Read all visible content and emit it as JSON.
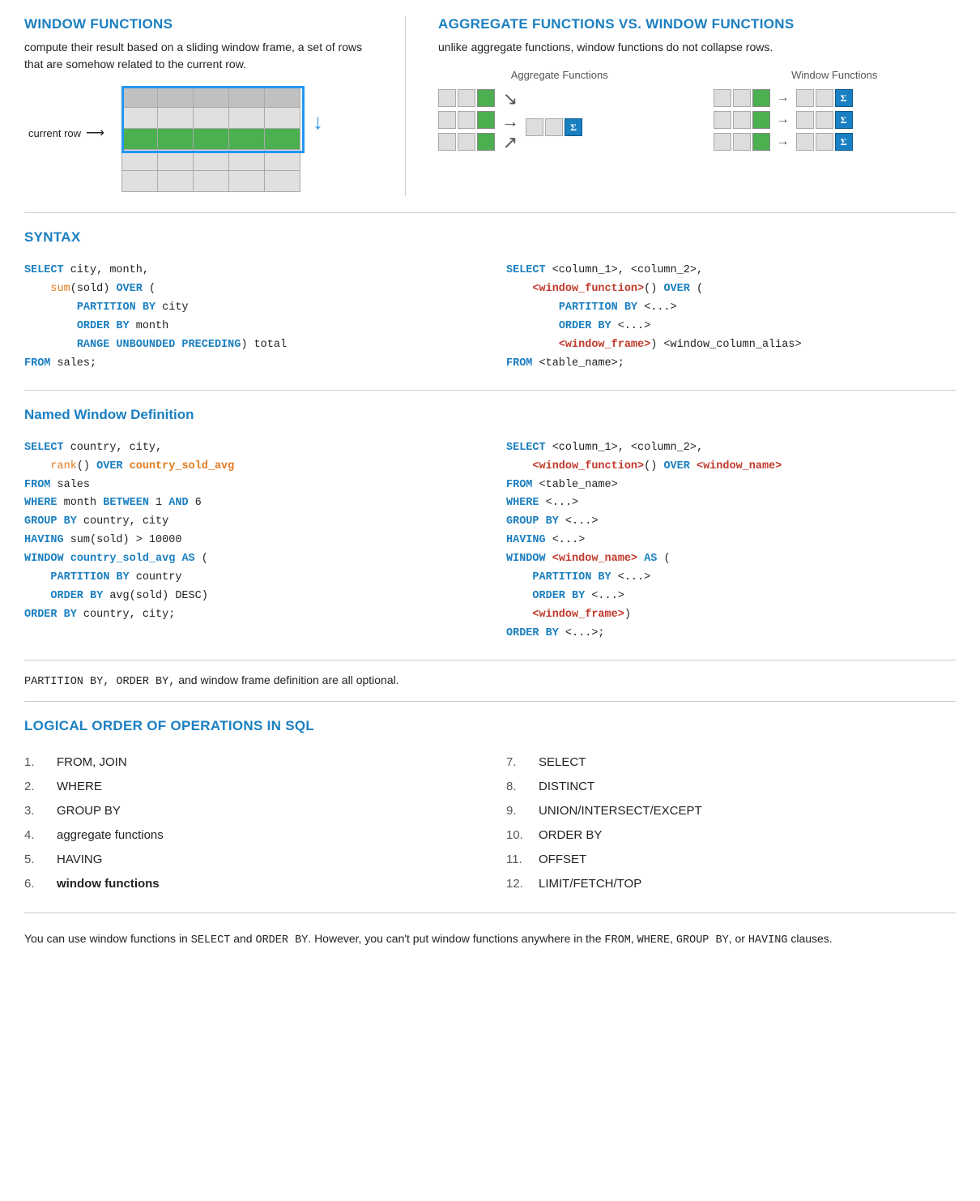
{
  "windowFunctions": {
    "title": "WINDOW FUNCTIONS",
    "description": "compute their result based on a sliding window frame, a set of rows that are somehow related to the current row.",
    "currentRowLabel": "current row"
  },
  "aggregateVsWindow": {
    "title": "AGGREGATE FUNCTIONS VS. WINDOW FUNCTIONS",
    "description": "unlike aggregate functions, window functions do not collapse rows.",
    "aggregateLabel": "Aggregate Functions",
    "windowLabel": "Window Functions"
  },
  "syntax": {
    "title": "SYNTAX",
    "example1": {
      "lines": [
        {
          "parts": [
            {
              "text": "SELECT",
              "cls": "kw-blue"
            },
            {
              "text": " city, month,",
              "cls": "normal"
            }
          ]
        },
        {
          "parts": [
            {
              "text": "    ",
              "cls": "normal"
            },
            {
              "text": "sum",
              "cls": "fn-orange"
            },
            {
              "text": "(sold) ",
              "cls": "normal"
            },
            {
              "text": "OVER",
              "cls": "kw-blue"
            },
            {
              "text": " (",
              "cls": "normal"
            }
          ]
        },
        {
          "parts": [
            {
              "text": "        ",
              "cls": "normal"
            },
            {
              "text": "PARTITION BY",
              "cls": "kw-blue"
            },
            {
              "text": " city",
              "cls": "normal"
            }
          ]
        },
        {
          "parts": [
            {
              "text": "        ",
              "cls": "normal"
            },
            {
              "text": "ORDER BY",
              "cls": "kw-blue"
            },
            {
              "text": " month",
              "cls": "normal"
            }
          ]
        },
        {
          "parts": [
            {
              "text": "        ",
              "cls": "normal"
            },
            {
              "text": "RANGE UNBOUNDED PRECEDING",
              "cls": "kw-blue"
            },
            {
              "text": ") total",
              "cls": "normal"
            }
          ]
        },
        {
          "parts": [
            {
              "text": "FROM",
              "cls": "kw-blue"
            },
            {
              "text": " sales;",
              "cls": "normal"
            }
          ]
        }
      ]
    },
    "example2": {
      "lines": [
        {
          "parts": [
            {
              "text": "SELECT",
              "cls": "kw-blue"
            },
            {
              "text": " <column_1>, <column_2>,",
              "cls": "normal"
            }
          ]
        },
        {
          "parts": [
            {
              "text": "    ",
              "cls": "normal"
            },
            {
              "text": "<window_function>",
              "cls": "angle"
            },
            {
              "text": "() ",
              "cls": "normal"
            },
            {
              "text": "OVER",
              "cls": "kw-blue"
            },
            {
              "text": " (",
              "cls": "normal"
            }
          ]
        },
        {
          "parts": [
            {
              "text": "        ",
              "cls": "normal"
            },
            {
              "text": "PARTITION BY",
              "cls": "kw-blue"
            },
            {
              "text": " <...>",
              "cls": "normal"
            }
          ]
        },
        {
          "parts": [
            {
              "text": "        ",
              "cls": "normal"
            },
            {
              "text": "ORDER BY",
              "cls": "kw-blue"
            },
            {
              "text": " <...>",
              "cls": "normal"
            }
          ]
        },
        {
          "parts": [
            {
              "text": "        ",
              "cls": "normal"
            },
            {
              "text": "<window_frame>",
              "cls": "angle"
            },
            {
              "text": ") <window_column_alias>",
              "cls": "normal"
            }
          ]
        },
        {
          "parts": [
            {
              "text": "FROM",
              "cls": "kw-blue"
            },
            {
              "text": " <table_name>;",
              "cls": "normal"
            }
          ]
        }
      ]
    }
  },
  "namedWindow": {
    "title": "Named Window Definition",
    "example1": {
      "lines": [
        {
          "parts": [
            {
              "text": "SELECT",
              "cls": "kw-blue"
            },
            {
              "text": " country, city,",
              "cls": "normal"
            }
          ]
        },
        {
          "parts": [
            {
              "text": "    ",
              "cls": "normal"
            },
            {
              "text": "rank",
              "cls": "fn-orange"
            },
            {
              "text": "() ",
              "cls": "normal"
            },
            {
              "text": "OVER",
              "cls": "kw-blue"
            },
            {
              "text": " ",
              "cls": "normal"
            },
            {
              "text": "country_sold_avg",
              "cls": "kw-orange"
            }
          ]
        },
        {
          "parts": [
            {
              "text": "FROM",
              "cls": "kw-blue"
            },
            {
              "text": " sales",
              "cls": "normal"
            }
          ]
        },
        {
          "parts": [
            {
              "text": "WHERE",
              "cls": "kw-blue"
            },
            {
              "text": " month ",
              "cls": "normal"
            },
            {
              "text": "BETWEEN",
              "cls": "kw-blue"
            },
            {
              "text": " 1 ",
              "cls": "normal"
            },
            {
              "text": "AND",
              "cls": "kw-blue"
            },
            {
              "text": " 6",
              "cls": "normal"
            }
          ]
        },
        {
          "parts": [
            {
              "text": "GROUP BY",
              "cls": "kw-blue"
            },
            {
              "text": " country, city",
              "cls": "normal"
            }
          ]
        },
        {
          "parts": [
            {
              "text": "HAVING",
              "cls": "kw-blue"
            },
            {
              "text": " sum(sold) > 10000",
              "cls": "normal"
            }
          ]
        },
        {
          "parts": [
            {
              "text": "WINDOW",
              "cls": "kw-blue"
            },
            {
              "text": " ",
              "cls": "normal"
            },
            {
              "text": "country_sold_avg",
              "cls": "kw-blue"
            },
            {
              "text": " ",
              "cls": "normal"
            },
            {
              "text": "AS",
              "cls": "kw-blue"
            },
            {
              "text": " (",
              "cls": "normal"
            }
          ]
        },
        {
          "parts": [
            {
              "text": "    ",
              "cls": "normal"
            },
            {
              "text": "PARTITION BY",
              "cls": "kw-blue"
            },
            {
              "text": " country",
              "cls": "normal"
            }
          ]
        },
        {
          "parts": [
            {
              "text": "    ",
              "cls": "normal"
            },
            {
              "text": "ORDER BY",
              "cls": "kw-blue"
            },
            {
              "text": " avg(sold) DESC)",
              "cls": "normal"
            }
          ]
        },
        {
          "parts": [
            {
              "text": "ORDER BY",
              "cls": "kw-blue"
            },
            {
              "text": " country, city;",
              "cls": "normal"
            }
          ]
        }
      ]
    },
    "example2": {
      "lines": [
        {
          "parts": [
            {
              "text": "SELECT",
              "cls": "kw-blue"
            },
            {
              "text": " <column_1>, <column_2>,",
              "cls": "normal"
            }
          ]
        },
        {
          "parts": [
            {
              "text": "    ",
              "cls": "normal"
            },
            {
              "text": "<window_function>",
              "cls": "angle"
            },
            {
              "text": "() ",
              "cls": "normal"
            },
            {
              "text": "OVER",
              "cls": "kw-blue"
            },
            {
              "text": " ",
              "cls": "normal"
            },
            {
              "text": "<window_name>",
              "cls": "angle"
            }
          ]
        },
        {
          "parts": [
            {
              "text": "FROM",
              "cls": "kw-blue"
            },
            {
              "text": " <table_name>",
              "cls": "normal"
            }
          ]
        },
        {
          "parts": [
            {
              "text": "WHERE",
              "cls": "kw-blue"
            },
            {
              "text": " <...>",
              "cls": "normal"
            }
          ]
        },
        {
          "parts": [
            {
              "text": "GROUP BY",
              "cls": "kw-blue"
            },
            {
              "text": " <...>",
              "cls": "normal"
            }
          ]
        },
        {
          "parts": [
            {
              "text": "HAVING",
              "cls": "kw-blue"
            },
            {
              "text": " <...>",
              "cls": "normal"
            }
          ]
        },
        {
          "parts": [
            {
              "text": "WINDOW",
              "cls": "kw-blue"
            },
            {
              "text": " ",
              "cls": "normal"
            },
            {
              "text": "<window_name>",
              "cls": "angle"
            },
            {
              "text": " ",
              "cls": "normal"
            },
            {
              "text": "AS",
              "cls": "kw-blue"
            },
            {
              "text": " (",
              "cls": "normal"
            }
          ]
        },
        {
          "parts": [
            {
              "text": "    ",
              "cls": "normal"
            },
            {
              "text": "PARTITION BY",
              "cls": "kw-blue"
            },
            {
              "text": " <...>",
              "cls": "normal"
            }
          ]
        },
        {
          "parts": [
            {
              "text": "    ",
              "cls": "normal"
            },
            {
              "text": "ORDER BY",
              "cls": "kw-blue"
            },
            {
              "text": " <...>",
              "cls": "normal"
            }
          ]
        },
        {
          "parts": [
            {
              "text": "    ",
              "cls": "normal"
            },
            {
              "text": "<window_frame>",
              "cls": "angle"
            },
            {
              "text": ")",
              "cls": "normal"
            }
          ]
        },
        {
          "parts": [
            {
              "text": "ORDER BY",
              "cls": "kw-blue"
            },
            {
              "text": " <...>;",
              "cls": "normal"
            }
          ]
        }
      ]
    }
  },
  "optionalNote": {
    "text": "PARTITION BY, ORDER BY, and window frame definition are all optional."
  },
  "logicalOrder": {
    "title": "LOGICAL ORDER OF OPERATIONS IN SQL",
    "col1": [
      {
        "num": "1.",
        "text": "FROM, JOIN",
        "bold": false
      },
      {
        "num": "2.",
        "text": "WHERE",
        "bold": false
      },
      {
        "num": "3.",
        "text": "GROUP BY",
        "bold": false
      },
      {
        "num": "4.",
        "text": "aggregate functions",
        "bold": false
      },
      {
        "num": "5.",
        "text": "HAVING",
        "bold": false
      },
      {
        "num": "6.",
        "text": "window functions",
        "bold": true
      }
    ],
    "col2": [
      {
        "num": "7.",
        "text": "SELECT",
        "bold": false
      },
      {
        "num": "8.",
        "text": "DISTINCT",
        "bold": false
      },
      {
        "num": "9.",
        "text": "UNION/INTERSECT/EXCEPT",
        "bold": false
      },
      {
        "num": "10.",
        "text": "ORDER BY",
        "bold": false
      },
      {
        "num": "11.",
        "text": "OFFSET",
        "bold": false
      },
      {
        "num": "12.",
        "text": "LIMIT/FETCH/TOP",
        "bold": false
      }
    ]
  },
  "footerNote": {
    "text1": "You can use window functions in SELECT and ORDER BY.",
    "text2": " However, you can't put window functions anywhere in the FROM, WHERE, GROUP BY, or HAVING clauses."
  }
}
